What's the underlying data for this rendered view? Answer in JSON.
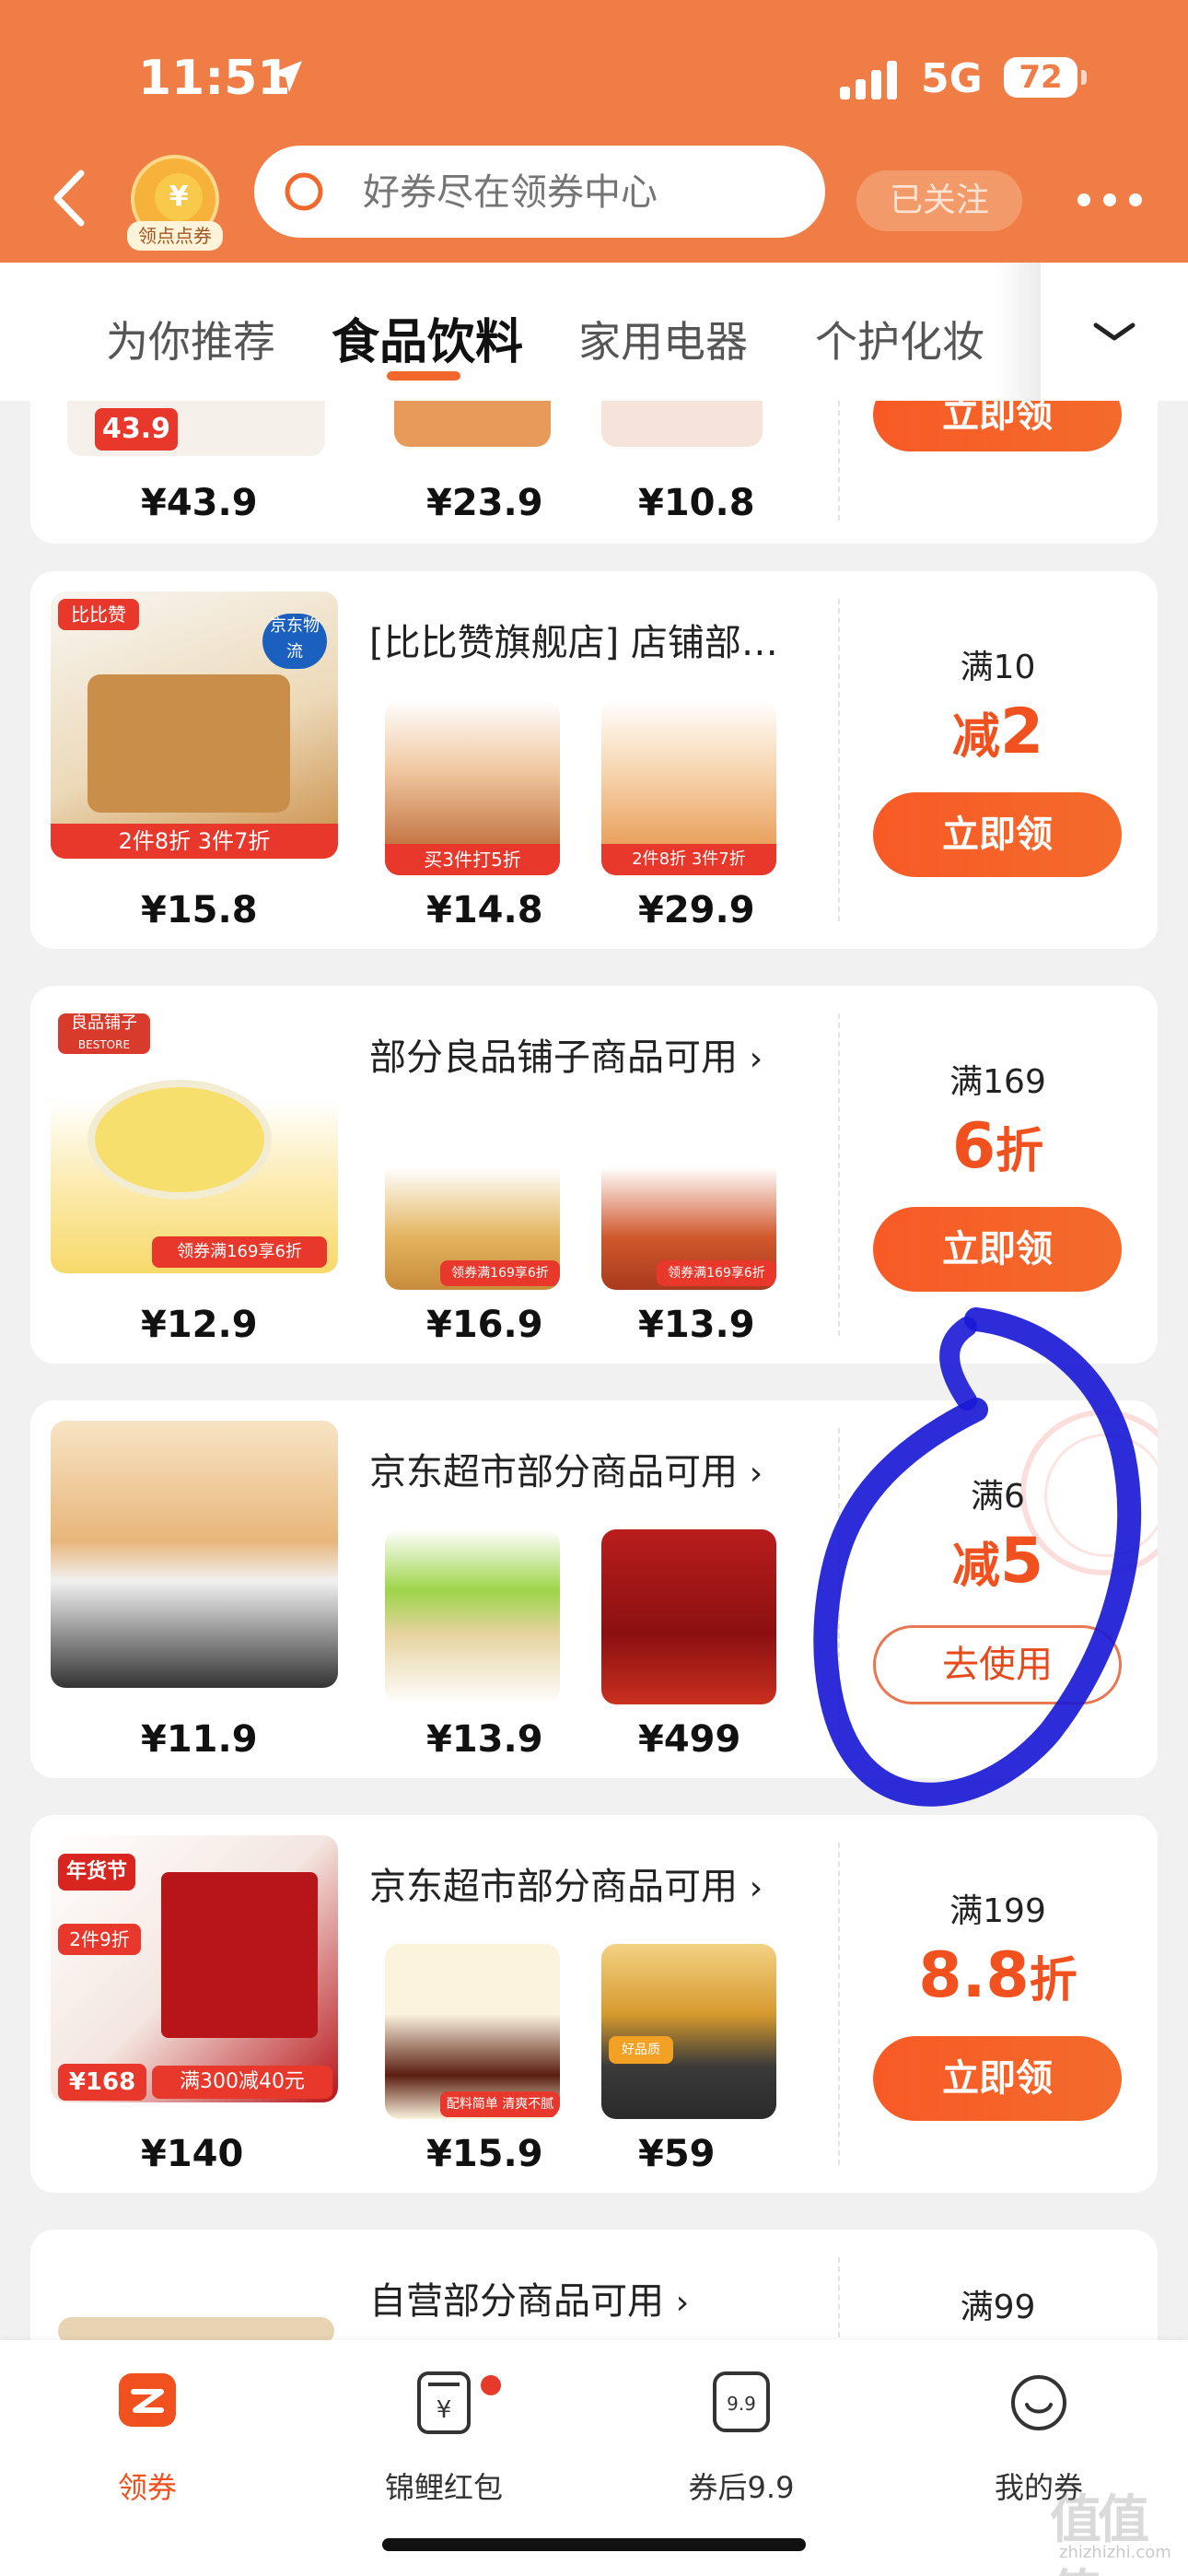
{
  "status_bar": {
    "time": "11:51",
    "network": "5G",
    "battery": "72"
  },
  "header": {
    "coin_label": "领点点券",
    "coin_symbol": "¥",
    "search_placeholder": "好券尽在领券中心",
    "follow_label": "已关注"
  },
  "tabs": [
    {
      "label": "为你推荐",
      "active": false
    },
    {
      "label": "食品饮料",
      "active": true
    },
    {
      "label": "家用电器",
      "active": false
    },
    {
      "label": "个护化妆",
      "active": false
    }
  ],
  "cards": [
    {
      "prices": [
        "¥43.9",
        "¥23.9",
        "¥10.8"
      ],
      "main_price_tag": "43.9",
      "button": "立即领"
    },
    {
      "title": "[比比赞旗舰店] 店铺部…",
      "prices": [
        "¥15.8",
        "¥14.8",
        "¥29.9"
      ],
      "threshold": "满10",
      "discount_prefix": "减",
      "discount_value": "2",
      "discount_suffix": "",
      "button": "立即领",
      "tags": {
        "main": "2件8折 3件7折",
        "small1": "买3件打5折",
        "small2": "2件8折 3件7折",
        "brand": "比比赞",
        "logistics": "京东物流"
      }
    },
    {
      "title": "部分良品铺子商品可用",
      "prices": [
        "¥12.9",
        "¥16.9",
        "¥13.9"
      ],
      "threshold": "满169",
      "discount_prefix": "",
      "discount_value": "6",
      "discount_suffix": "折",
      "button": "立即领",
      "tags": {
        "main": "领券满169享6折",
        "brand": "良品铺子",
        "brand_en": "BESTORE",
        "small1": "领券满169享6折",
        "small2": "领券满169享6折"
      }
    },
    {
      "title": "京东超市部分商品可用",
      "prices": [
        "¥11.9",
        "¥13.9",
        "¥499"
      ],
      "threshold": "满6",
      "discount_prefix": "减",
      "discount_value": "5",
      "discount_suffix": "",
      "button": "去使用"
    },
    {
      "title": "京东超市部分商品可用",
      "prices": [
        "¥140",
        "¥15.9",
        "¥59"
      ],
      "threshold": "满199",
      "discount_prefix": "",
      "discount_value": "8.8",
      "discount_suffix": "折",
      "button": "立即领",
      "tags": {
        "festival": "年货节",
        "main": "满300减40元",
        "main_price": "168",
        "promo": "2件9折",
        "small1": "配料简单 清爽不腻",
        "small2": "好品质"
      }
    },
    {
      "title": "自营部分商品可用",
      "threshold": "满99"
    }
  ],
  "bottom_nav": [
    {
      "label": "领券",
      "icon": "coupon-icon",
      "active": true
    },
    {
      "label": "锦鲤红包",
      "icon": "red-packet-icon",
      "active": false
    },
    {
      "label": "券后9.9",
      "icon": "price-tag-icon",
      "active": false,
      "icon_text": "9.9"
    },
    {
      "label": "我的券",
      "icon": "smile-icon",
      "active": false
    }
  ],
  "watermark": {
    "text": "值值值",
    "sub": "zhizhizhi.com"
  },
  "colors": {
    "brand": "#f07d45",
    "accent": "#f0511e",
    "annotation": "#1a1ad6"
  }
}
